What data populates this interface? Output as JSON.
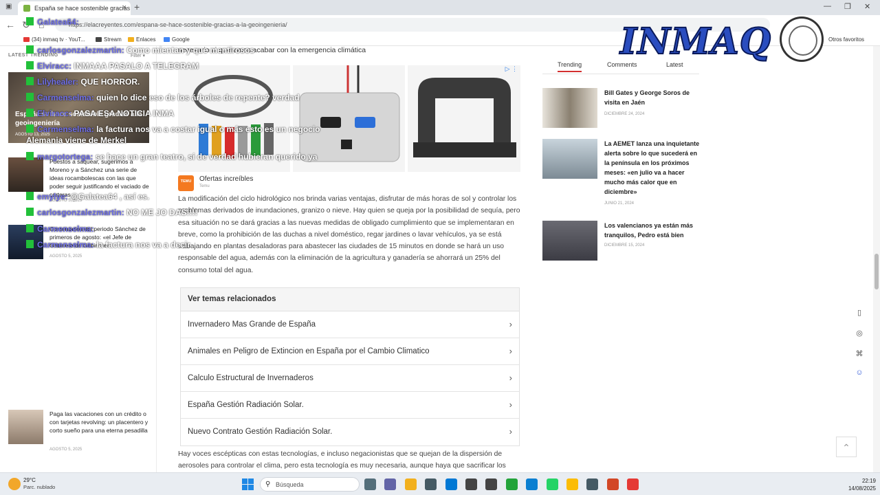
{
  "browser": {
    "tab_title": "España se hace sostenible gracias a la geoingeniería",
    "url": "https://elacreyentes.com/espana-se-hace-sostenible-gracias-a-la-geoingenieria/",
    "bookmarks": [
      {
        "label": "(34) inmaq tv · YouT...",
        "color": "#e53935"
      },
      {
        "label": "Stream",
        "color": "#444444"
      },
      {
        "label": "Enlaces",
        "color": "#f2b01e"
      },
      {
        "label": "Google",
        "color": "#4285f4"
      }
    ],
    "other_favorites": "Otros favoritos"
  },
  "left_column": {
    "tabs": "LATEST   TRENDING",
    "filter": "Filter ▾",
    "featured": {
      "title": "España se hace sostenible gracias a la geoingeniería",
      "date": "AGOSTO 13, 2025"
    },
    "items": [
      {
        "title": "Puestos a saquear, sugerimos a Moreno y a Sánchez una serie de ideas rocambolescas con las que poder seguir justificando el vaciado de carteras",
        "date": "AGOSTO 5, 2025"
      },
      {
        "title": "Comentarios del periodo Sánchez de primeros de agosto: «el Jefe de Gabinete de Gabinete»",
        "date": "AGOSTO 5, 2025"
      },
      {
        "title": "Paga las vacaciones con un crédito o con tarjetas revolving: un placentero y corto sueño para una eterna pesadilla",
        "date": "AGOSTO 5, 2025"
      }
    ]
  },
  "main": {
    "intro_line": "necesario si queremos acabar con la emergencia climática",
    "ad": {
      "brand": "Ofertas increíbles",
      "sub": "Temu",
      "logo_text": "TEMU"
    },
    "paragraph_1": "La modificación del ciclo hidrológico nos brinda varias ventajas, disfrutar de más horas de sol y controlar los problemas derivados de inundaciones, granizo o nieve. Hay quien se queja por la posibilidad de sequía, pero esa situación no se dará gracias a las nuevas medidas de obligado cumplimiento que se implementaran en breve, como la prohibición de las duchas a nivel doméstico, regar jardines o lavar vehículos, ya se está trabajando en plantas desaladoras para abastecer las ciudades de 15 minutos en donde se hará un uso responsable del agua, además con la eliminación de la agricultura y ganadería se ahorrará un 25% del consumo total del agua.",
    "related": {
      "heading": "Ver temas relacionados",
      "items": [
        "Invernadero Mas Grande de España",
        "Animales en Peligro de Extincion en España por el Cambio Climatico",
        "Calculo Estructural de Invernaderos",
        "España Gestión Radiación Solar.",
        "Nuevo Contrato Gestión Radiación Solar."
      ]
    },
    "paragraph_2": "Hay voces escépticas con estas tecnologías, e incluso negacionistas que se quejan de la dispersión de aerosoles para controlar el clima, pero esta tecnología es muy necesaria, aunque haya que sacrificar los"
  },
  "sidebar": {
    "tabs": [
      "Trending",
      "Comments",
      "Latest"
    ],
    "items": [
      {
        "title": "Bill Gates y George Soros de visita en Jaén",
        "date": "DICIEMBRE 24, 2024"
      },
      {
        "title": "La AEMET lanza una inquietante alerta sobre lo que sucederá en la península en los próximos meses: «en julio va a hacer mucho más calor que en diciembre»",
        "date": "JUNIO 21, 2024"
      },
      {
        "title": "Los valencianos ya están más tranquilos, Pedro está bien",
        "date": "DICIEMBRE 15, 2024"
      }
    ]
  },
  "chat": [
    {
      "user": "Galatea64:",
      "msg": ""
    },
    {
      "user": "carlosgonzalezmartin:",
      "msg": "Como mientan y que mentirosos"
    },
    {
      "user": "Elviracc:",
      "msg": "INMAAA PASALO A TELEGRAM"
    },
    {
      "user": "Lilyhealer:",
      "msg": "QUE HORROR."
    },
    {
      "user": "Carmenselma:",
      "msg": "quien lo dice eso de los árboles de repente? verdad"
    },
    {
      "user": "Elviracc:",
      "msg": "PASA ESA NOTICIA INMA"
    },
    {
      "user": "Carmenselma:",
      "msg": "la factura nos va a costar igual o más esto es un negocio"
    },
    {
      "user": "",
      "msg": "Alemania viene de Merkel"
    },
    {
      "user": "margotortega:",
      "msg": "se hace un gran teatro, si de verdad hubieran querido ya"
    },
    {
      "user": "emylye:",
      "msg": "@Galatea64 , así es."
    },
    {
      "user": "carlosgonzalezmartin:",
      "msg": "NO ME JO DAS!!!!"
    },
    {
      "user": "Carmenselma:",
      "msg": ""
    },
    {
      "user": "Carmenselma:",
      "msg": "la factura nos va a decir"
    }
  ],
  "logo": {
    "text": "INMAQ"
  },
  "taskbar": {
    "temp": "29°C",
    "weather": "Parc. nublado",
    "search": "Búsqueda",
    "time": "22:19",
    "date": "14/08/2025",
    "apps": [
      "#546e7a",
      "#6264a7",
      "#f2b01e",
      "#455a64",
      "#0078d4",
      "#444444",
      "#444444",
      "#22a33a",
      "#0b7fd1",
      "#25d366",
      "#fbbc05",
      "#455a64",
      "#d24726",
      "#e53935"
    ]
  },
  "colors": {
    "chat_user": "#6f6fe8",
    "chat_badge": "#22c03a",
    "accent": "#d32f2f"
  }
}
